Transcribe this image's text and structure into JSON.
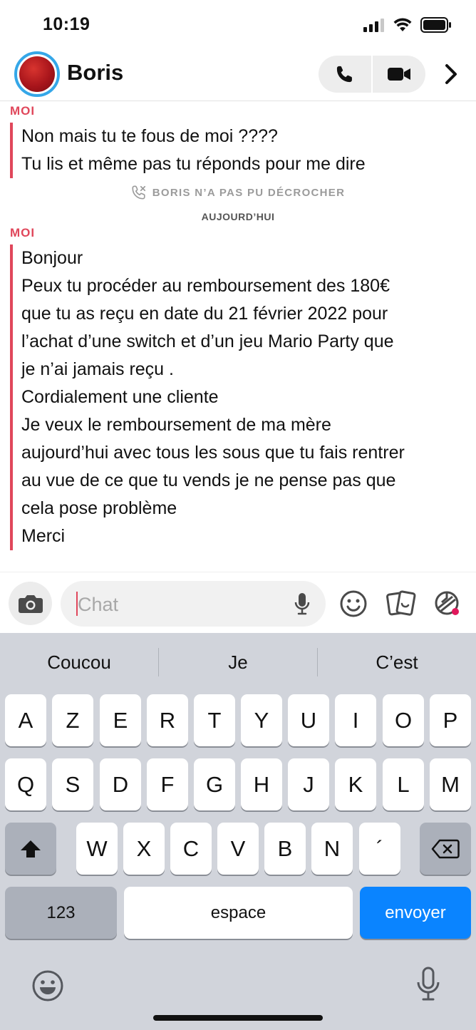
{
  "status": {
    "time": "10:19"
  },
  "header": {
    "name": "Boris"
  },
  "messages": [
    {
      "sender": "MOI",
      "lines": [
        "Non mais tu te fous de moi ????",
        "Tu lis et même pas tu réponds pour me dire"
      ]
    },
    {
      "sender": "MOI",
      "lines": [
        "Bonjour",
        "Peux tu procéder au remboursement des 180€",
        "que tu as reçu en date du 21 février 2022 pour",
        "l’achat d’une switch et d’un jeu Mario Party que",
        "je n’ai jamais reçu .",
        "Cordialement une cliente",
        "Je veux le remboursement de ma mère",
        "aujourd’hui avec tous les sous que tu fais rentrer",
        "au vue de ce que tu vends je ne pense pas que",
        "cela pose problème",
        "Merci"
      ]
    }
  ],
  "missed_call": "BORIS N’A PAS PU DÉCROCHER",
  "date_separator": "AUJOURD’HUI",
  "composer": {
    "placeholder": "Chat"
  },
  "keyboard": {
    "suggestions": [
      "Coucou",
      "Je",
      "C’est"
    ],
    "row1": [
      "A",
      "Z",
      "E",
      "R",
      "T",
      "Y",
      "U",
      "I",
      "O",
      "P"
    ],
    "row2": [
      "Q",
      "S",
      "D",
      "F",
      "G",
      "H",
      "J",
      "K",
      "L",
      "M"
    ],
    "row3": [
      "W",
      "X",
      "C",
      "V",
      "B",
      "N",
      "´"
    ],
    "numbers_label": "123",
    "space_label": "espace",
    "send_label": "envoyer"
  },
  "colors": {
    "accent_red": "#e0475b",
    "send_blue": "#0a84ff",
    "avatar_ring": "#35a7e8"
  }
}
